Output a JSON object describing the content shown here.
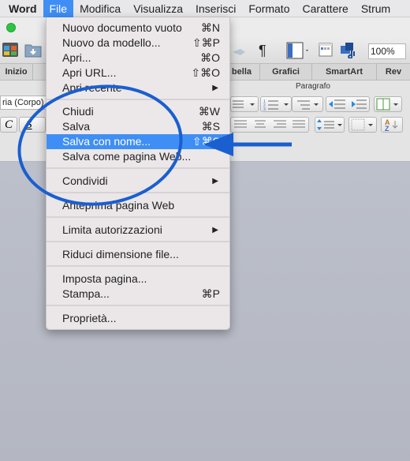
{
  "menubar": {
    "items": [
      "Word",
      "File",
      "Modifica",
      "Visualizza",
      "Inserisci",
      "Formato",
      "Carattere",
      "Strum"
    ]
  },
  "toolbar": {
    "zoom_value": "100%"
  },
  "ribbon": {
    "tabs": [
      "Inizio",
      "bella",
      "Grafici",
      "SmartArt",
      "Rev"
    ],
    "group_label": "Paragrafo",
    "font_field": "ria (Corpo)",
    "format_buttons": [
      "C",
      "S"
    ]
  },
  "file_menu": {
    "items": [
      {
        "label": "Nuovo documento vuoto",
        "shortcut": "⌘N"
      },
      {
        "label": "Nuovo da modello...",
        "shortcut": "⇧⌘P"
      },
      {
        "label": "Apri...",
        "shortcut": "⌘O"
      },
      {
        "label": "Apri URL...",
        "shortcut": "⇧⌘O"
      },
      {
        "label": "Apri recente",
        "submenu": true
      },
      {
        "label": "Chiudi",
        "shortcut": "⌘W"
      },
      {
        "label": "Salva",
        "shortcut": "⌘S"
      },
      {
        "label": "Salva con nome...",
        "shortcut": "⇧⌘S",
        "highlighted": true
      },
      {
        "label": "Salva come pagina Web..."
      },
      {
        "label": "Condividi",
        "submenu": true
      },
      {
        "label": "Anteprima pagina Web"
      },
      {
        "label": "Limita autorizzazioni",
        "submenu": true
      },
      {
        "label": "Riduci dimensione file..."
      },
      {
        "label": "Imposta pagina..."
      },
      {
        "label": "Stampa...",
        "shortcut": "⌘P"
      },
      {
        "label": "Proprietà..."
      }
    ],
    "submenu_arrow": "▶"
  },
  "annotation": {
    "color": "#1a5fd0",
    "shapes": [
      "circle",
      "arrow"
    ]
  },
  "colors": {
    "highlight": "#3f8ef5",
    "annotation": "#1a5fd0"
  }
}
